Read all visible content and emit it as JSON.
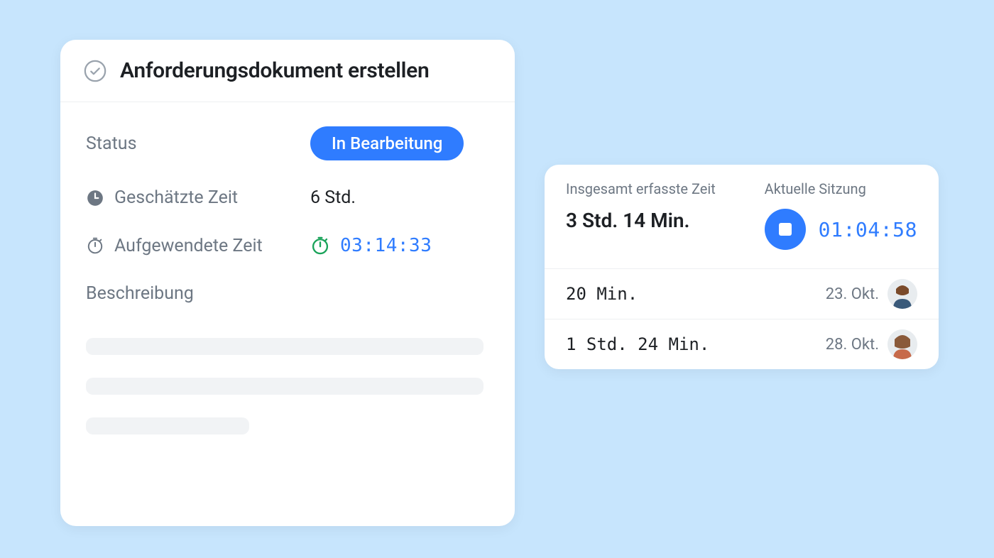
{
  "task": {
    "title": "Anforderungsdokument erstellen",
    "status_label": "Status",
    "status_value": "In Bearbeitung",
    "estimated_label": "Geschätzte Zeit",
    "estimated_value": "6 Std.",
    "spent_label": "Aufgewendete Zeit",
    "spent_value": "03:14:33",
    "description_label": "Beschreibung"
  },
  "timetrack": {
    "total_label": "Insgesamt erfasste Zeit",
    "total_value": "3 Std. 14 Min.",
    "session_label": "Aktuelle Sitzung",
    "session_timer": "01:04:58",
    "entries": [
      {
        "duration": "20 Min.",
        "date": "23. Okt."
      },
      {
        "duration": "1 Std. 24 Min.",
        "date": "28. Okt."
      }
    ]
  },
  "colors": {
    "accent": "#2f7cff",
    "background": "#c7e5fd",
    "success": "#1aa35a"
  }
}
